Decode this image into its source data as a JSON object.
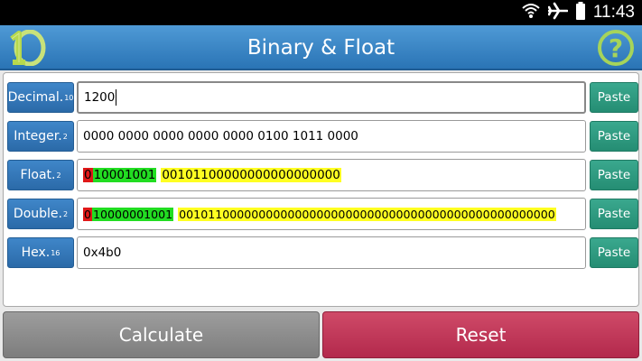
{
  "status_bar": {
    "time": "11:43",
    "icons": [
      "wifi-icon",
      "airplane-mode-icon",
      "battery-icon"
    ]
  },
  "app_bar": {
    "title": "Binary & Float",
    "logo_icon": "app-logo-icon",
    "help_icon": "help-icon"
  },
  "rows": [
    {
      "label": "Decimal.",
      "base": "10",
      "value": "1200",
      "paste": "Paste"
    },
    {
      "label": "Integer.",
      "base": "2",
      "value": "0000 0000 0000 0000 0000 0100 1011 0000",
      "paste": "Paste"
    },
    {
      "label": "Float.",
      "base": "2",
      "sign": "0",
      "exponent": "10001001",
      "mantissa": "00101100000000000000000",
      "paste": "Paste"
    },
    {
      "label": "Double.",
      "base": "2",
      "sign": "0",
      "exponent": "10000001001",
      "mantissa": "0010110000000000000000000000000000000000000000000000",
      "paste": "Paste"
    },
    {
      "label": "Hex.",
      "base": "16",
      "value": "0x4b0",
      "paste": "Paste"
    }
  ],
  "buttons": {
    "calculate": "Calculate",
    "reset": "Reset"
  },
  "colors": {
    "app_bar": "#3a85c6",
    "label_button": "#2f72b3",
    "paste_button": "#2e9b80",
    "calculate_button": "#8d8d8d",
    "reset_button": "#c0385a",
    "sign_highlight": "#e01818",
    "exponent_highlight": "#22dd22",
    "mantissa_highlight": "#ffff22"
  }
}
